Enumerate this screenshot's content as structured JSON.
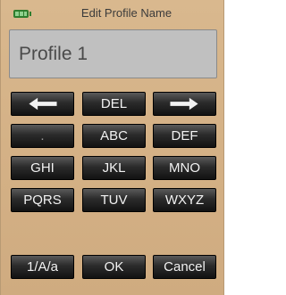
{
  "title": "Edit Profile Name",
  "field": {
    "value": "Profile 1"
  },
  "keys": {
    "left_arrow_icon": "left-arrow-icon",
    "del": "DEL",
    "right_arrow_icon": "right-arrow-icon",
    "punct": ".",
    "abc": "ABC",
    "def": "DEF",
    "ghi": "GHI",
    "jkl": "JKL",
    "mno": "MNO",
    "pqrs": "PQRS",
    "tuv": "TUV",
    "wxyz": "WXYZ",
    "mode": "1/A/a",
    "ok": "OK",
    "cancel": "Cancel"
  },
  "colors": {
    "background": "#d4b186",
    "key": "#1e1e1e",
    "battery": "#2e7d2e"
  }
}
